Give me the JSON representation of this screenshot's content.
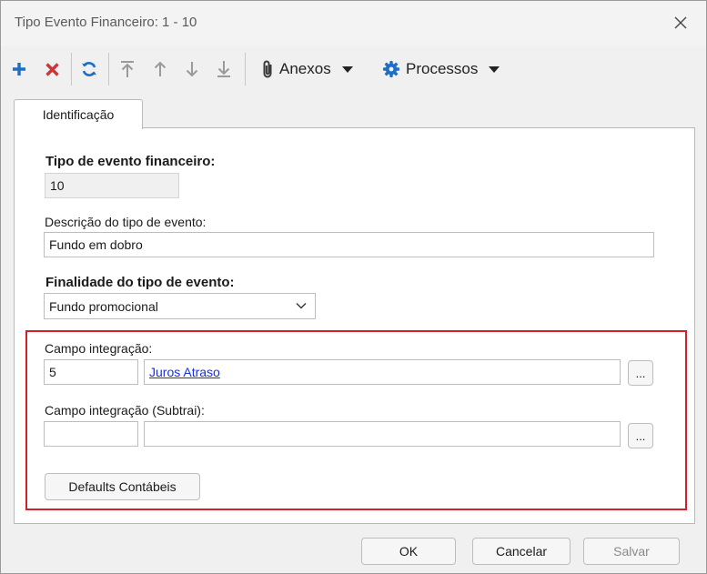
{
  "window": {
    "title": "Tipo Evento Financeiro: 1 - 10"
  },
  "toolbar": {
    "attachments_label": "Anexos",
    "processes_label": "Processos"
  },
  "tabs": [
    {
      "label": "Identificação"
    }
  ],
  "form": {
    "tipo_evento": {
      "label": "Tipo de evento financeiro:",
      "value": "10"
    },
    "descricao": {
      "label": "Descrição do tipo de evento:",
      "value": "Fundo em dobro"
    },
    "finalidade": {
      "label": "Finalidade do tipo de evento:",
      "value": "Fundo promocional"
    },
    "campo_integracao": {
      "label": "Campo integração:",
      "code": "5",
      "description": "Juros Atraso",
      "lookup_label": "..."
    },
    "campo_integracao_subtrai": {
      "label": "Campo integração (Subtrai):",
      "code": "",
      "description": "",
      "lookup_label": "..."
    },
    "defaults_button": "Defaults Contábeis"
  },
  "footer": {
    "ok": "OK",
    "cancel": "Cancelar",
    "save": "Salvar"
  },
  "colors": {
    "accent_blue": "#1e6fc4",
    "delete_red": "#d13438",
    "highlight_red": "#d21f2a",
    "link": "#1a2ee6"
  }
}
